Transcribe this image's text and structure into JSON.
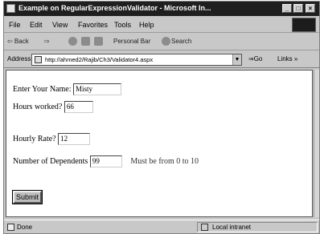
{
  "window": {
    "title": "Example on RegularExpressionValidator - Microsoft In...",
    "buttons": [
      "_",
      "□",
      "×"
    ]
  },
  "menubar": {
    "items": [
      "File",
      "Edit",
      "View",
      "Favorites",
      "Tools",
      "Help"
    ]
  },
  "toolbar": {
    "back": "⇦ Back",
    "forward": "⇨",
    "personal_bar": "Personal Bar",
    "search": "Search"
  },
  "address": {
    "label": "Address",
    "url": "http://ahmed2/Rajib/Ch3/Validator4.aspx",
    "go": "Go",
    "links": "Links »"
  },
  "form": {
    "name_label": "Enter Your Name:",
    "name_value": "Misty",
    "hours_label": "Hours worked?",
    "hours_value": "66",
    "rate_label": "Hourly Rate?",
    "rate_value": "12",
    "dependents_label": "Number of Dependents",
    "dependents_value": "99",
    "dependents_error": "Must be from 0 to 10",
    "submit_label": "Submit"
  },
  "status": {
    "text": "Done",
    "zone": "Local intranet"
  }
}
